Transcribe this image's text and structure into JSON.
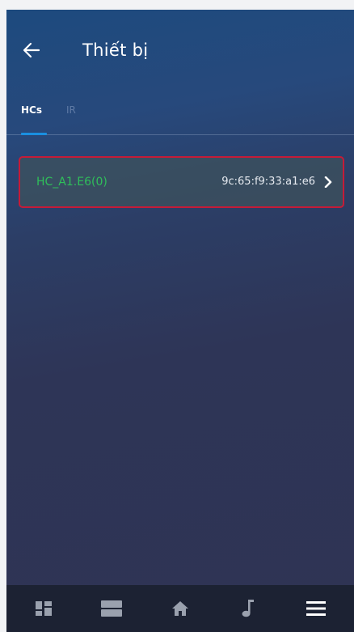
{
  "header": {
    "title": "Thiết bị",
    "back_icon": "arrow-left-icon"
  },
  "tabs": [
    {
      "label": "HCs",
      "active": true
    },
    {
      "label": "IR",
      "active": false
    }
  ],
  "devices": [
    {
      "name": "HC_A1.E6(0)",
      "mac": "9c:65:f9:33:a1:e6",
      "icon": "chevron-right-icon"
    }
  ],
  "bottom_nav": [
    {
      "icon": "dashboard-icon"
    },
    {
      "icon": "rooms-icon"
    },
    {
      "icon": "home-icon"
    },
    {
      "icon": "music-note-icon"
    },
    {
      "icon": "menu-icon"
    }
  ],
  "colors": {
    "accent": "#1a8fe0",
    "device_name": "#2fbf5a",
    "selection_border": "#c51b38",
    "nav_background": "#1c2233"
  }
}
